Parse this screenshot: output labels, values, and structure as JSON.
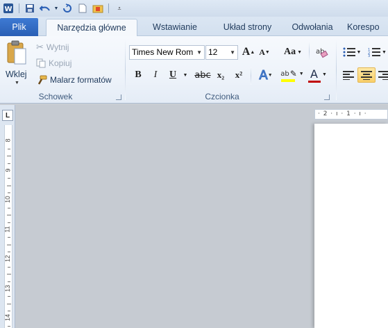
{
  "qat": {
    "icons": [
      "word-icon",
      "save-icon",
      "undo-icon",
      "undo-dropdown-icon",
      "redo-icon",
      "new-document-icon",
      "open-icon",
      "customize-qat-icon"
    ]
  },
  "tabs": {
    "file": "Plik",
    "home": "Narzędzia główne",
    "insert": "Wstawianie",
    "layout": "Układ strony",
    "references": "Odwołania",
    "mailings": "Korespo"
  },
  "clipboard": {
    "paste": "Wklej",
    "cut": "Wytnij",
    "copy": "Kopiuj",
    "format_painter": "Malarz formatów",
    "group": "Schowek"
  },
  "font": {
    "name": "Times New Rom",
    "size": "12",
    "bold": "B",
    "italic": "I",
    "underline": "U",
    "strike": "abc",
    "subscript": "x₂",
    "superscript": "x²",
    "change_case": "Aa",
    "grow": "A",
    "shrink": "A",
    "highlight_text": "ab",
    "font_color_text": "A",
    "group": "Czcionka"
  },
  "ruler": {
    "corner": "L",
    "horizontal": "· 2 · ı · 1 · ı ·",
    "vertical_numbers": [
      "8",
      "9",
      "10",
      "11",
      "12",
      "13",
      "14"
    ]
  },
  "colors": {
    "file_tab": "#2a5fb5",
    "highlight": "#ffff00",
    "font_color": "#c00000",
    "accent": "#1e395b"
  }
}
